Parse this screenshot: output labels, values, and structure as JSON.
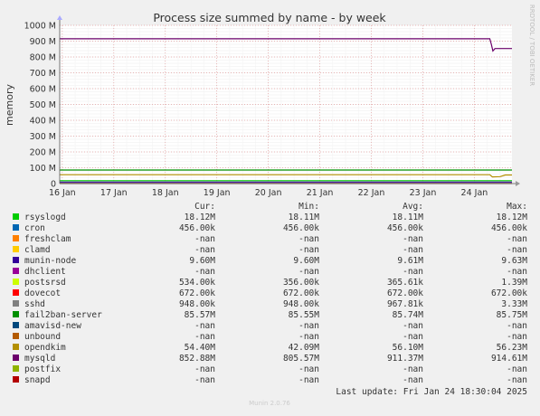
{
  "chart_data": {
    "type": "line",
    "title": "Process size summed by name - by week",
    "ylabel": "memory",
    "xlabel": "",
    "ylim": [
      0,
      1000000000
    ],
    "y_ticks": [
      {
        "value": 0,
        "label": "0"
      },
      {
        "value": 100000000,
        "label": "100 M"
      },
      {
        "value": 200000000,
        "label": "200 M"
      },
      {
        "value": 300000000,
        "label": "300 M"
      },
      {
        "value": 400000000,
        "label": "400 M"
      },
      {
        "value": 500000000,
        "label": "500 M"
      },
      {
        "value": 600000000,
        "label": "600 M"
      },
      {
        "value": 700000000,
        "label": "700 M"
      },
      {
        "value": 800000000,
        "label": "800 M"
      },
      {
        "value": 900000000,
        "label": "900 M"
      },
      {
        "value": 1000000000,
        "label": "1000 M"
      }
    ],
    "x_ticks": [
      "16 Jan",
      "17 Jan",
      "18 Jan",
      "19 Jan",
      "20 Jan",
      "21 Jan",
      "22 Jan",
      "23 Jan",
      "24 Jan"
    ],
    "xlim": [
      15.95,
      24.73
    ],
    "grid": true,
    "side_label": "RRDTOOL / TOBI OETIKER",
    "legend_headers": {
      "cur": "Cur:",
      "min": "Min:",
      "avg": "Avg:",
      "max": "Max:"
    },
    "series": [
      {
        "name": "rsyslogd",
        "color": "#00cc00",
        "cur": "18.12M",
        "min": "18.11M",
        "avg": "18.11M",
        "max": "18.12M",
        "points": [
          [
            15.95,
            18120000
          ],
          [
            24.73,
            18120000
          ]
        ]
      },
      {
        "name": "cron",
        "color": "#0066b3",
        "cur": "456.00k",
        "min": "456.00k",
        "avg": "456.00k",
        "max": "456.00k",
        "points": [
          [
            15.95,
            456000
          ],
          [
            24.73,
            456000
          ]
        ]
      },
      {
        "name": "freshclam",
        "color": "#ff8000",
        "cur": "-nan",
        "min": "-nan",
        "avg": "-nan",
        "max": "-nan",
        "points": []
      },
      {
        "name": "clamd",
        "color": "#ffcc00",
        "cur": "-nan",
        "min": "-nan",
        "avg": "-nan",
        "max": "-nan",
        "points": []
      },
      {
        "name": "munin-node",
        "color": "#330099",
        "cur": "9.60M",
        "min": "9.60M",
        "avg": "9.61M",
        "max": "9.63M",
        "points": [
          [
            15.95,
            9610000
          ],
          [
            24.73,
            9600000
          ]
        ]
      },
      {
        "name": "dhclient",
        "color": "#990099",
        "cur": "-nan",
        "min": "-nan",
        "avg": "-nan",
        "max": "-nan",
        "points": []
      },
      {
        "name": "postsrsd",
        "color": "#ccff00",
        "cur": "534.00k",
        "min": "356.00k",
        "avg": "365.61k",
        "max": "1.39M",
        "points": [
          [
            15.95,
            360000
          ],
          [
            24.73,
            534000
          ]
        ]
      },
      {
        "name": "dovecot",
        "color": "#ff0000",
        "cur": "672.00k",
        "min": "672.00k",
        "avg": "672.00k",
        "max": "672.00k",
        "points": [
          [
            15.95,
            672000
          ],
          [
            24.73,
            672000
          ]
        ]
      },
      {
        "name": "sshd",
        "color": "#808080",
        "cur": "948.00k",
        "min": "948.00k",
        "avg": "967.81k",
        "max": "3.33M",
        "points": [
          [
            15.95,
            950000
          ],
          [
            24.73,
            948000
          ]
        ]
      },
      {
        "name": "fail2ban-server",
        "color": "#008f00",
        "cur": "85.57M",
        "min": "85.55M",
        "avg": "85.74M",
        "max": "85.75M",
        "points": [
          [
            15.95,
            85750000
          ],
          [
            24.1,
            85750000
          ],
          [
            24.73,
            85570000
          ]
        ]
      },
      {
        "name": "amavisd-new",
        "color": "#00487d",
        "cur": "-nan",
        "min": "-nan",
        "avg": "-nan",
        "max": "-nan",
        "points": []
      },
      {
        "name": "unbound",
        "color": "#b35a00",
        "cur": "-nan",
        "min": "-nan",
        "avg": "-nan",
        "max": "-nan",
        "points": []
      },
      {
        "name": "opendkim",
        "color": "#b38f00",
        "cur": "54.40M",
        "min": "42.09M",
        "avg": "56.10M",
        "max": "56.23M",
        "points": [
          [
            15.95,
            56200000
          ],
          [
            24.3,
            56200000
          ],
          [
            24.35,
            42100000
          ],
          [
            24.5,
            44000000
          ],
          [
            24.6,
            54400000
          ],
          [
            24.73,
            54400000
          ]
        ]
      },
      {
        "name": "mysqld",
        "color": "#6b006b",
        "cur": "852.88M",
        "min": "805.57M",
        "avg": "911.37M",
        "max": "914.61M",
        "points": [
          [
            15.95,
            914600000
          ],
          [
            24.3,
            914600000
          ],
          [
            24.33,
            880000000
          ],
          [
            24.36,
            838000000
          ],
          [
            24.4,
            852900000
          ],
          [
            24.73,
            852880000
          ]
        ]
      },
      {
        "name": "postfix",
        "color": "#8fb300",
        "cur": "-nan",
        "min": "-nan",
        "avg": "-nan",
        "max": "-nan",
        "points": []
      },
      {
        "name": "snapd",
        "color": "#b30000",
        "cur": "-nan",
        "min": "-nan",
        "avg": "-nan",
        "max": "-nan",
        "points": []
      }
    ]
  },
  "footer": {
    "last_update": "Last update: Fri Jan 24 18:30:04 2025",
    "version": "Munin 2.0.76"
  }
}
